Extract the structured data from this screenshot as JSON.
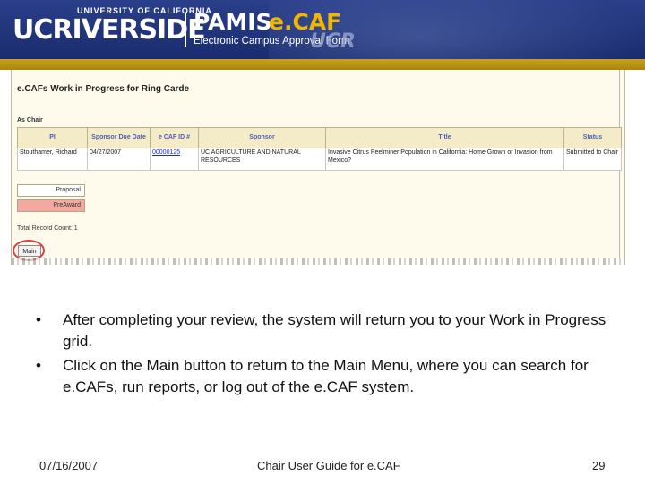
{
  "banner": {
    "uc_logo": "UCRIVERSIDE",
    "university": "UNIVERSITY OF CALIFORNIA",
    "pamis": "PAMIS",
    "ecaf": "e.CAF",
    "subtitle": "Electronic Campus Approval Form",
    "ucr_watermark": "UCR",
    "colors": {
      "banner_blue": "#1a2c6e",
      "gold": "#c9a21a",
      "ecaf_gold": "#f2b600"
    }
  },
  "screen": {
    "heading": "e.CAFs Work in Progress for Ring Carde",
    "section_label": "As Chair",
    "table": {
      "headers": [
        "PI",
        "Sponsor Due Date",
        "e CAF ID #",
        "Sponsor",
        "Title",
        "Status"
      ],
      "rows": [
        {
          "pi": "Stouthamer, Richard",
          "due_date": "04/27/2007",
          "ecaf_id": "00000125",
          "sponsor": "UC AGRICULTURE AND NATURAL RESOURCES",
          "title": "Invasive Citrus Peelminer Population in California: Home Grown or Invasion from Mexico?",
          "status": "Submitted to Chair"
        }
      ]
    },
    "legend": {
      "proposal": "Proposal",
      "preaward": "PreAward"
    },
    "total_count": "Total Record Count: 1",
    "main_button": "Main"
  },
  "bullets": [
    "After completing your review, the system will return you to your Work in Progress grid.",
    "Click on the Main button to return to the Main Menu, where you can search for e.CAFs, run reports, or log out of the e.CAF system."
  ],
  "footer": {
    "date": "07/16/2007",
    "title": "Chair User Guide for e.CAF",
    "page": "29"
  }
}
